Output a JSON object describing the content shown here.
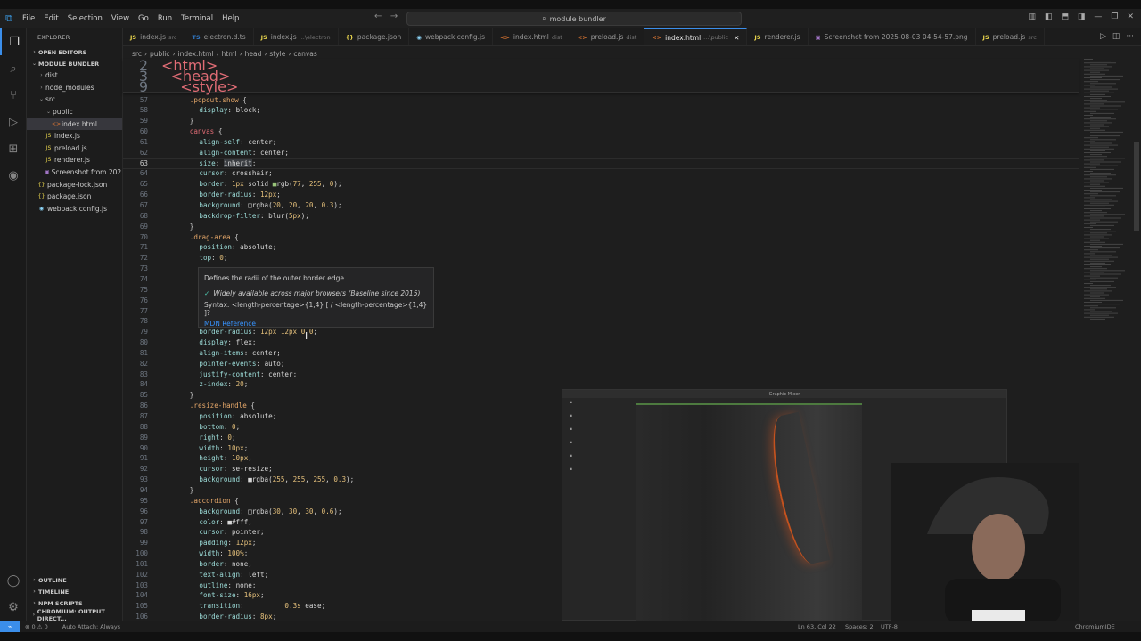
{
  "menu": [
    "File",
    "Edit",
    "Selection",
    "View",
    "Go",
    "Run",
    "Terminal",
    "Help"
  ],
  "command_center": "module bundler",
  "explorer": {
    "title": "EXPLORER",
    "open_editors": "OPEN EDITORS",
    "project": "MODULE BUNDLER",
    "tree": [
      {
        "label": "dist",
        "depth": 1,
        "type": "folder",
        "open": false
      },
      {
        "label": "node_modules",
        "depth": 1,
        "type": "folder",
        "open": false
      },
      {
        "label": "src",
        "depth": 1,
        "type": "folder",
        "open": true
      },
      {
        "label": "public",
        "depth": 2,
        "type": "folder",
        "open": true
      },
      {
        "label": "index.html",
        "depth": 3,
        "type": "html",
        "selected": true
      },
      {
        "label": "index.js",
        "depth": 2,
        "type": "js"
      },
      {
        "label": "preload.js",
        "depth": 2,
        "type": "js"
      },
      {
        "label": "renderer.js",
        "depth": 2,
        "type": "js"
      },
      {
        "label": "Screenshot from 202...",
        "depth": 2,
        "type": "img"
      },
      {
        "label": "package-lock.json",
        "depth": 1,
        "type": "json"
      },
      {
        "label": "package.json",
        "depth": 1,
        "type": "json"
      },
      {
        "label": "webpack.config.js",
        "depth": 1,
        "type": "cfg"
      }
    ],
    "bottom_sections": [
      "OUTLINE",
      "TIMELINE",
      "NPM SCRIPTS",
      "CHROMIUM: OUTPUT DIRECT..."
    ]
  },
  "tabs": [
    {
      "icon": "JS",
      "label": "index.js",
      "sub": "src"
    },
    {
      "icon": "TS",
      "label": "electron.d.ts",
      "sub": ""
    },
    {
      "icon": "JS",
      "label": "index.js",
      "sub": "...\\electron"
    },
    {
      "icon": "{}",
      "label": "package.json",
      "sub": ""
    },
    {
      "icon": "◉",
      "label": "webpack.config.js",
      "sub": ""
    },
    {
      "icon": "<>",
      "label": "index.html",
      "sub": "dist"
    },
    {
      "icon": "<>",
      "label": "preload.js",
      "sub": "dist"
    },
    {
      "icon": "<>",
      "label": "index.html",
      "sub": "...\\public",
      "active": true
    },
    {
      "icon": "JS",
      "label": "renderer.js",
      "sub": ""
    },
    {
      "icon": "▣",
      "label": "Screenshot from 2025-08-03 04-54-57.png",
      "sub": ""
    },
    {
      "icon": "JS",
      "label": "preload.js",
      "sub": "src"
    }
  ],
  "breadcrumb": [
    "src",
    "public",
    "index.html",
    "html",
    "head",
    "style",
    "canvas"
  ],
  "sticky": [
    {
      "n": "2",
      "code": [
        [
          "k-tag",
          "<html>"
        ]
      ],
      "indent": 0
    },
    {
      "n": "3",
      "code": [
        [
          "k-tag",
          "<head>"
        ]
      ],
      "indent": 1
    },
    {
      "n": "9",
      "code": [
        [
          "k-tag",
          "<style>"
        ]
      ],
      "indent": 2
    }
  ],
  "lines": [
    {
      "n": "57",
      "c": [
        [
          "k-sel",
          ".popout.show "
        ],
        [
          "k-pun",
          "{"
        ]
      ],
      "i": 3
    },
    {
      "n": "58",
      "c": [
        [
          "k-prop",
          "display"
        ],
        [
          "k-pun",
          ": "
        ],
        [
          "k-val",
          "block"
        ],
        [
          "k-pun",
          ";"
        ]
      ],
      "i": 4
    },
    {
      "n": "59",
      "c": [
        [
          "k-pun",
          "}"
        ]
      ],
      "i": 3
    },
    {
      "n": "60",
      "c": [
        [
          "k-tag",
          "canvas "
        ],
        [
          "k-pun",
          "{"
        ]
      ],
      "i": 3
    },
    {
      "n": "61",
      "c": [
        [
          "k-prop",
          "align-self"
        ],
        [
          "k-pun",
          ": "
        ],
        [
          "k-val",
          "center"
        ],
        [
          "k-pun",
          ";"
        ]
      ],
      "i": 4
    },
    {
      "n": "62",
      "c": [
        [
          "k-prop",
          "align-content"
        ],
        [
          "k-pun",
          ": "
        ],
        [
          "k-val",
          "center"
        ],
        [
          "k-pun",
          ";"
        ]
      ],
      "i": 4
    },
    {
      "n": "63",
      "c": [
        [
          "k-prop",
          "size"
        ],
        [
          "k-pun",
          ": "
        ],
        [
          "k-val",
          "inherit"
        ],
        [
          "k-pun",
          ";"
        ]
      ],
      "i": 4,
      "cur": true
    },
    {
      "n": "64",
      "c": [
        [
          "k-prop",
          "cursor"
        ],
        [
          "k-pun",
          ": "
        ],
        [
          "k-val",
          "crosshair"
        ],
        [
          "k-pun",
          ";"
        ]
      ],
      "i": 4
    },
    {
      "n": "65",
      "c": [
        [
          "k-prop",
          "border"
        ],
        [
          "k-pun",
          ": "
        ],
        [
          "k-num",
          "1px"
        ],
        [
          "k-val",
          " solid "
        ],
        [
          "k-str",
          "■"
        ],
        [
          "k-val",
          "rgb("
        ],
        [
          "k-num",
          "77"
        ],
        [
          "k-val",
          ", "
        ],
        [
          "k-num",
          "255"
        ],
        [
          "k-val",
          ", "
        ],
        [
          "k-num",
          "0"
        ],
        [
          "k-val",
          ")"
        ],
        [
          "k-pun",
          ";"
        ]
      ],
      "i": 4
    },
    {
      "n": "66",
      "c": [
        [
          "k-prop",
          "border-radius"
        ],
        [
          "k-pun",
          ": "
        ],
        [
          "k-num",
          "12px"
        ],
        [
          "k-pun",
          ";"
        ]
      ],
      "i": 4
    },
    {
      "n": "67",
      "c": [
        [
          "k-prop",
          "background"
        ],
        [
          "k-pun",
          ": "
        ],
        [
          "k-val",
          "□rgba("
        ],
        [
          "k-num",
          "20"
        ],
        [
          "k-val",
          ", "
        ],
        [
          "k-num",
          "20"
        ],
        [
          "k-val",
          ", "
        ],
        [
          "k-num",
          "20"
        ],
        [
          "k-val",
          ", "
        ],
        [
          "k-num",
          "0.3"
        ],
        [
          "k-val",
          ")"
        ],
        [
          "k-pun",
          ";"
        ]
      ],
      "i": 4
    },
    {
      "n": "68",
      "c": [
        [
          "k-prop",
          "backdrop-filter"
        ],
        [
          "k-pun",
          ": "
        ],
        [
          "k-val",
          "blur("
        ],
        [
          "k-num",
          "5px"
        ],
        [
          "k-val",
          ")"
        ],
        [
          "k-pun",
          ";"
        ]
      ],
      "i": 4
    },
    {
      "n": "69",
      "c": [
        [
          "k-pun",
          "}"
        ]
      ],
      "i": 3
    },
    {
      "n": "70",
      "c": [
        [
          "k-sel",
          ".drag-area "
        ],
        [
          "k-pun",
          "{"
        ]
      ],
      "i": 3
    },
    {
      "n": "71",
      "c": [
        [
          "k-prop",
          "position"
        ],
        [
          "k-pun",
          ": "
        ],
        [
          "k-val",
          "absolute"
        ],
        [
          "k-pun",
          ";"
        ]
      ],
      "i": 4
    },
    {
      "n": "72",
      "c": [
        [
          "k-prop",
          "top"
        ],
        [
          "k-pun",
          ": "
        ],
        [
          "k-num",
          "0"
        ],
        [
          "k-pun",
          ";"
        ]
      ],
      "i": 4
    },
    {
      "n": "73",
      "c": [],
      "i": 4
    },
    {
      "n": "74",
      "c": [],
      "i": 4
    },
    {
      "n": "75",
      "c": [],
      "i": 4
    },
    {
      "n": "76",
      "c": [],
      "i": 4
    },
    {
      "n": "77",
      "c": [],
      "i": 4
    },
    {
      "n": "78",
      "c": [],
      "i": 4
    },
    {
      "n": "79",
      "c": [
        [
          "k-prop",
          "border-radius"
        ],
        [
          "k-pun",
          ": "
        ],
        [
          "k-num",
          "12px 12px 0 0"
        ],
        [
          "k-pun",
          ";"
        ]
      ],
      "i": 4
    },
    {
      "n": "80",
      "c": [
        [
          "k-prop",
          "display"
        ],
        [
          "k-pun",
          ": "
        ],
        [
          "k-val",
          "flex"
        ],
        [
          "k-pun",
          ";"
        ]
      ],
      "i": 4
    },
    {
      "n": "81",
      "c": [
        [
          "k-prop",
          "align-items"
        ],
        [
          "k-pun",
          ": "
        ],
        [
          "k-val",
          "center"
        ],
        [
          "k-pun",
          ";"
        ]
      ],
      "i": 4
    },
    {
      "n": "82",
      "c": [
        [
          "k-prop",
          "pointer-events"
        ],
        [
          "k-pun",
          ": "
        ],
        [
          "k-val",
          "auto"
        ],
        [
          "k-pun",
          ";"
        ]
      ],
      "i": 4
    },
    {
      "n": "83",
      "c": [
        [
          "k-prop",
          "justify-content"
        ],
        [
          "k-pun",
          ": "
        ],
        [
          "k-val",
          "center"
        ],
        [
          "k-pun",
          ";"
        ]
      ],
      "i": 4
    },
    {
      "n": "84",
      "c": [
        [
          "k-prop",
          "z-index"
        ],
        [
          "k-pun",
          ": "
        ],
        [
          "k-num",
          "20"
        ],
        [
          "k-pun",
          ";"
        ]
      ],
      "i": 4
    },
    {
      "n": "85",
      "c": [
        [
          "k-pun",
          "}"
        ]
      ],
      "i": 3
    },
    {
      "n": "86",
      "c": [
        [
          "k-sel",
          ".resize-handle "
        ],
        [
          "k-pun",
          "{"
        ]
      ],
      "i": 3
    },
    {
      "n": "87",
      "c": [
        [
          "k-prop",
          "position"
        ],
        [
          "k-pun",
          ": "
        ],
        [
          "k-val",
          "absolute"
        ],
        [
          "k-pun",
          ";"
        ]
      ],
      "i": 4
    },
    {
      "n": "88",
      "c": [
        [
          "k-prop",
          "bottom"
        ],
        [
          "k-pun",
          ": "
        ],
        [
          "k-num",
          "0"
        ],
        [
          "k-pun",
          ";"
        ]
      ],
      "i": 4
    },
    {
      "n": "89",
      "c": [
        [
          "k-prop",
          "right"
        ],
        [
          "k-pun",
          ": "
        ],
        [
          "k-num",
          "0"
        ],
        [
          "k-pun",
          ";"
        ]
      ],
      "i": 4
    },
    {
      "n": "90",
      "c": [
        [
          "k-prop",
          "width"
        ],
        [
          "k-pun",
          ": "
        ],
        [
          "k-num",
          "10px"
        ],
        [
          "k-pun",
          ";"
        ]
      ],
      "i": 4
    },
    {
      "n": "91",
      "c": [
        [
          "k-prop",
          "height"
        ],
        [
          "k-pun",
          ": "
        ],
        [
          "k-num",
          "10px"
        ],
        [
          "k-pun",
          ";"
        ]
      ],
      "i": 4
    },
    {
      "n": "92",
      "c": [
        [
          "k-prop",
          "cursor"
        ],
        [
          "k-pun",
          ": "
        ],
        [
          "k-val",
          "se-resize"
        ],
        [
          "k-pun",
          ";"
        ]
      ],
      "i": 4
    },
    {
      "n": "93",
      "c": [
        [
          "k-prop",
          "background"
        ],
        [
          "k-pun",
          ": "
        ],
        [
          "k-val",
          "■rgba("
        ],
        [
          "k-num",
          "255"
        ],
        [
          "k-val",
          ", "
        ],
        [
          "k-num",
          "255"
        ],
        [
          "k-val",
          ", "
        ],
        [
          "k-num",
          "255"
        ],
        [
          "k-val",
          ", "
        ],
        [
          "k-num",
          "0.3"
        ],
        [
          "k-val",
          ")"
        ],
        [
          "k-pun",
          ";"
        ]
      ],
      "i": 4
    },
    {
      "n": "94",
      "c": [
        [
          "k-pun",
          "}"
        ]
      ],
      "i": 3
    },
    {
      "n": "95",
      "c": [
        [
          "k-sel",
          ".accordion "
        ],
        [
          "k-pun",
          "{"
        ]
      ],
      "i": 3
    },
    {
      "n": "96",
      "c": [
        [
          "k-prop",
          "background"
        ],
        [
          "k-pun",
          ": "
        ],
        [
          "k-val",
          "□rgba("
        ],
        [
          "k-num",
          "30"
        ],
        [
          "k-val",
          ", "
        ],
        [
          "k-num",
          "30"
        ],
        [
          "k-val",
          ", "
        ],
        [
          "k-num",
          "30"
        ],
        [
          "k-val",
          ", "
        ],
        [
          "k-num",
          "0.6"
        ],
        [
          "k-val",
          ")"
        ],
        [
          "k-pun",
          ";"
        ]
      ],
      "i": 4
    },
    {
      "n": "97",
      "c": [
        [
          "k-prop",
          "color"
        ],
        [
          "k-pun",
          ": "
        ],
        [
          "k-val",
          "■#fff"
        ],
        [
          "k-pun",
          ";"
        ]
      ],
      "i": 4
    },
    {
      "n": "98",
      "c": [
        [
          "k-prop",
          "cursor"
        ],
        [
          "k-pun",
          ": "
        ],
        [
          "k-val",
          "pointer"
        ],
        [
          "k-pun",
          ";"
        ]
      ],
      "i": 4
    },
    {
      "n": "99",
      "c": [
        [
          "k-prop",
          "padding"
        ],
        [
          "k-pun",
          ": "
        ],
        [
          "k-num",
          "12px"
        ],
        [
          "k-pun",
          ";"
        ]
      ],
      "i": 4
    },
    {
      "n": "100",
      "c": [
        [
          "k-prop",
          "width"
        ],
        [
          "k-pun",
          ": "
        ],
        [
          "k-num",
          "100%"
        ],
        [
          "k-pun",
          ";"
        ]
      ],
      "i": 4
    },
    {
      "n": "101",
      "c": [
        [
          "k-prop",
          "border"
        ],
        [
          "k-pun",
          ": "
        ],
        [
          "k-val",
          "none"
        ],
        [
          "k-pun",
          ";"
        ]
      ],
      "i": 4
    },
    {
      "n": "102",
      "c": [
        [
          "k-prop",
          "text-align"
        ],
        [
          "k-pun",
          ": "
        ],
        [
          "k-val",
          "left"
        ],
        [
          "k-pun",
          ";"
        ]
      ],
      "i": 4
    },
    {
      "n": "103",
      "c": [
        [
          "k-prop",
          "outline"
        ],
        [
          "k-pun",
          ": "
        ],
        [
          "k-val",
          "none"
        ],
        [
          "k-pun",
          ";"
        ]
      ],
      "i": 4
    },
    {
      "n": "104",
      "c": [
        [
          "k-prop",
          "font-size"
        ],
        [
          "k-pun",
          ": "
        ],
        [
          "k-num",
          "16px"
        ],
        [
          "k-pun",
          ";"
        ]
      ],
      "i": 4
    },
    {
      "n": "105",
      "c": [
        [
          "k-prop",
          "transition"
        ],
        [
          "k-pun",
          ": "
        ],
        [
          "k-val",
          "         "
        ],
        [
          "k-num",
          "0.3s"
        ],
        [
          "k-val",
          " ease"
        ],
        [
          "k-pun",
          ";"
        ]
      ],
      "i": 4
    },
    {
      "n": "106",
      "c": [
        [
          "k-prop",
          "border-radius"
        ],
        [
          "k-pun",
          ": "
        ],
        [
          "k-num",
          "8px"
        ],
        [
          "k-pun",
          ";"
        ]
      ],
      "i": 4
    }
  ],
  "hover": {
    "title": "Defines the radii of the outer border edge.",
    "baseline": "Widely available across major browsers (Baseline since 2015)",
    "syntax": "Syntax: <length-percentage>{1,4} [ / <length-percentage>{1,4} ]?",
    "link": "MDN Reference"
  },
  "preview": {
    "title": "Graphic Mixer"
  },
  "statusbar": {
    "errors": "⊗ 0 ⚠ 0",
    "auto_attach": "Auto Attach: Always",
    "position": "Ln 63, Col 22",
    "spaces": "Spaces: 2",
    "encoding": "UTF-8",
    "ext": "ChromiumIDE"
  }
}
